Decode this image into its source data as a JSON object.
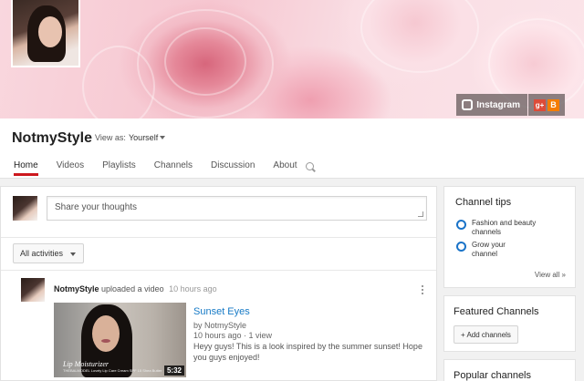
{
  "banner": {
    "social": {
      "instagram_label": "Instagram",
      "gplus_glyph": "g+",
      "blogger_glyph": "B"
    }
  },
  "header": {
    "channel_name": "NotmyStyle",
    "view_as_label": "View as:",
    "view_as_value": "Yourself",
    "tabs": [
      "Home",
      "Videos",
      "Playlists",
      "Channels",
      "Discussion",
      "About"
    ],
    "active_tab": "Home"
  },
  "share": {
    "placeholder": "Share your thoughts"
  },
  "filter": {
    "label": "All activities"
  },
  "post": {
    "user": "NotmyStyle",
    "action": "uploaded a video",
    "time": "10 hours ago",
    "video": {
      "thumb_title": "Lip Moisturizer",
      "thumb_subtitle": "THEBALMODEL Lovely Lip Care Cream SPF 15 Shea Butter",
      "duration": "5:32",
      "title": "Sunset Eyes",
      "by": "by NotmyStyle",
      "meta": "10 hours ago · 1 view",
      "description": "Heyy guys! This is a look inspired by the summer sunset! Hope you guys enjoyed!"
    }
  },
  "sidebar": {
    "tips": {
      "title": "Channel tips",
      "items": [
        "Fashion and beauty channels",
        "Grow your channel"
      ],
      "view_all": "View all »"
    },
    "featured": {
      "title": "Featured Channels",
      "button": "+ Add channels"
    },
    "popular": {
      "title": "Popular channels"
    }
  },
  "colors": {
    "accent_red": "#cc181e",
    "link_blue": "#167ac6",
    "tip_ring_blue": "#1a73c8"
  }
}
